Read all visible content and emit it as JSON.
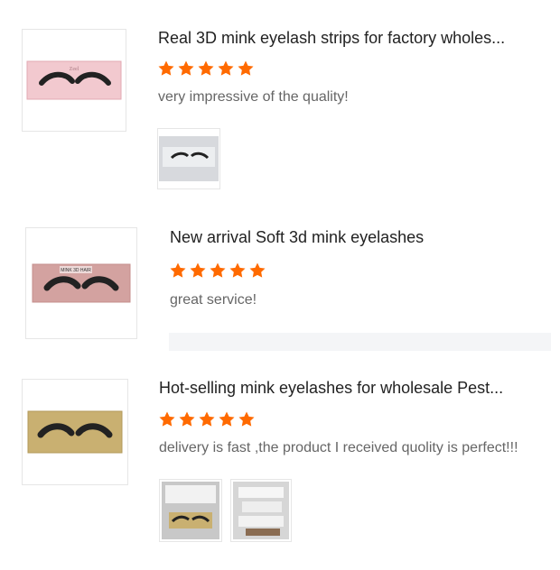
{
  "colors": {
    "star": "#ff6a00",
    "title": "#222222",
    "comment": "#666666"
  },
  "reviews": [
    {
      "title": "Real 3D mink eyelash strips for factory wholes...",
      "rating": 5,
      "comment": "very impressive of the quality!",
      "product_box_text": "Zeel",
      "photos_count": 1
    },
    {
      "title": "New arrival Soft 3d mink eyelashes",
      "rating": 5,
      "comment": "great service!",
      "product_box_text": "MINK 3D HAIR",
      "photos_count": 0
    },
    {
      "title": "Hot-selling mink eyelashes for wholesale Pest...",
      "rating": 5,
      "comment": "delivery is fast ,the product I received quolity is perfect!!!",
      "product_box_text": "",
      "photos_count": 2
    }
  ]
}
